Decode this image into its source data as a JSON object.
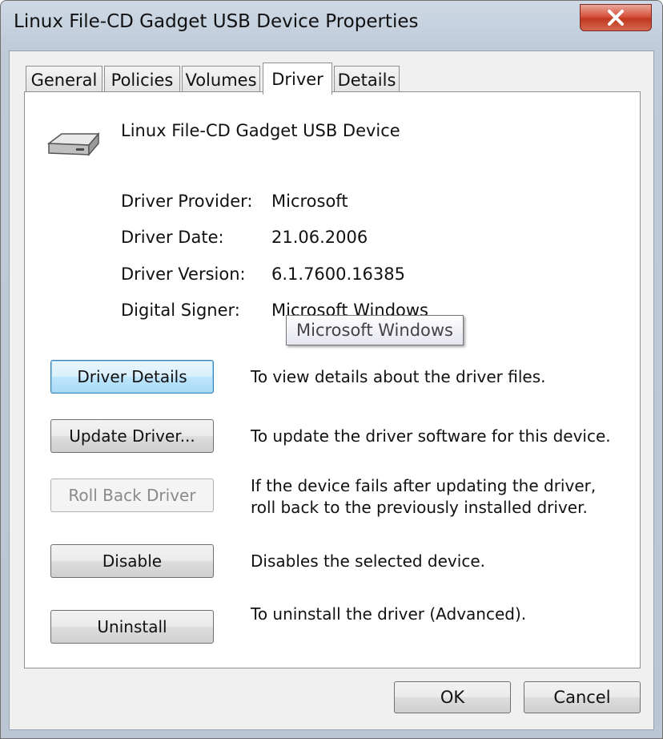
{
  "window": {
    "title": "Linux File-CD Gadget USB Device Properties"
  },
  "tabs": [
    {
      "label": "General"
    },
    {
      "label": "Policies"
    },
    {
      "label": "Volumes"
    },
    {
      "label": "Driver",
      "active": true
    },
    {
      "label": "Details"
    }
  ],
  "device": {
    "name": "Linux File-CD Gadget USB Device",
    "icon": "drive-icon"
  },
  "info": [
    {
      "label": "Driver Provider:",
      "value": "Microsoft"
    },
    {
      "label": "Driver Date:",
      "value": "21.06.2006"
    },
    {
      "label": "Driver Version:",
      "value": "6.1.7600.16385"
    },
    {
      "label": "Digital Signer:",
      "value": "Microsoft Windows"
    }
  ],
  "tooltip": {
    "text": "Microsoft Windows"
  },
  "actions": [
    {
      "label": "Driver Details",
      "description": "To view details about the driver files."
    },
    {
      "label": "Update Driver...",
      "description": "To update the driver software for this device."
    },
    {
      "label": "Roll Back Driver",
      "description": "If the device fails after updating the driver, roll back to the previously installed driver."
    },
    {
      "label": "Disable",
      "description": "Disables the selected device."
    },
    {
      "label": "Uninstall",
      "description": "To uninstall the driver (Advanced)."
    }
  ],
  "footer": {
    "ok_label": "OK",
    "cancel_label": "Cancel"
  },
  "colors": {
    "close_button": "#c0391f",
    "focused_button": "#bee6fd",
    "frame": "#bfcbd9"
  }
}
